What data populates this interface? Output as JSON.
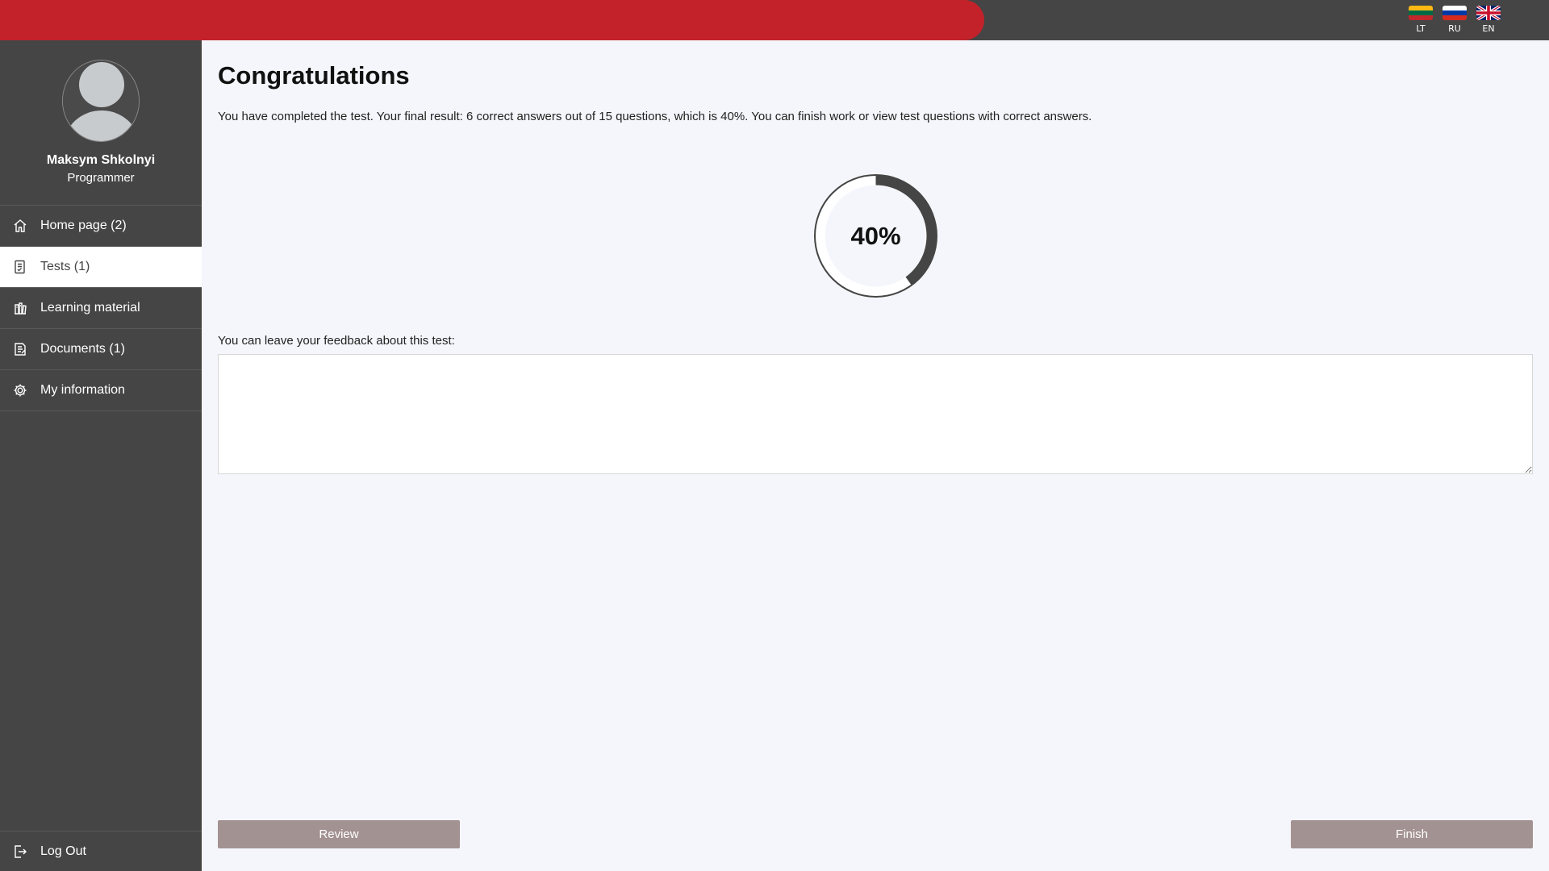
{
  "languages": [
    {
      "code": "LT",
      "flag": "lithuania-flag-icon"
    },
    {
      "code": "RU",
      "flag": "russia-flag-icon"
    },
    {
      "code": "EN",
      "flag": "uk-flag-icon"
    }
  ],
  "user": {
    "name": "Maksym Shkolnyi",
    "role": "Programmer"
  },
  "nav": {
    "items": [
      {
        "label": "Home page (2)",
        "icon": "home-icon",
        "active": false
      },
      {
        "label": "Tests (1)",
        "icon": "tests-icon",
        "active": true
      },
      {
        "label": "Learning material",
        "icon": "learning-material-icon",
        "active": false
      },
      {
        "label": "Documents (1)",
        "icon": "documents-icon",
        "active": false
      },
      {
        "label": "My information",
        "icon": "gear-icon",
        "active": false
      }
    ],
    "logout_label": "Log Out"
  },
  "main": {
    "title": "Congratulations",
    "result_text": "You have completed the test. Your final result: 6 correct answers out of 15 questions, which is 40%. You can finish work or view test questions with correct answers.",
    "progress_label": "40%",
    "progress_fraction": 0.4,
    "feedback_label": "You can leave your feedback about this test:",
    "feedback_value": "",
    "review_label": "Review",
    "finish_label": "Finish"
  },
  "colors": {
    "accent_red": "#c4222a",
    "sidebar": "#464545",
    "button": "#a39292",
    "page_bg": "#f5f6fb",
    "ring": "#464545"
  }
}
